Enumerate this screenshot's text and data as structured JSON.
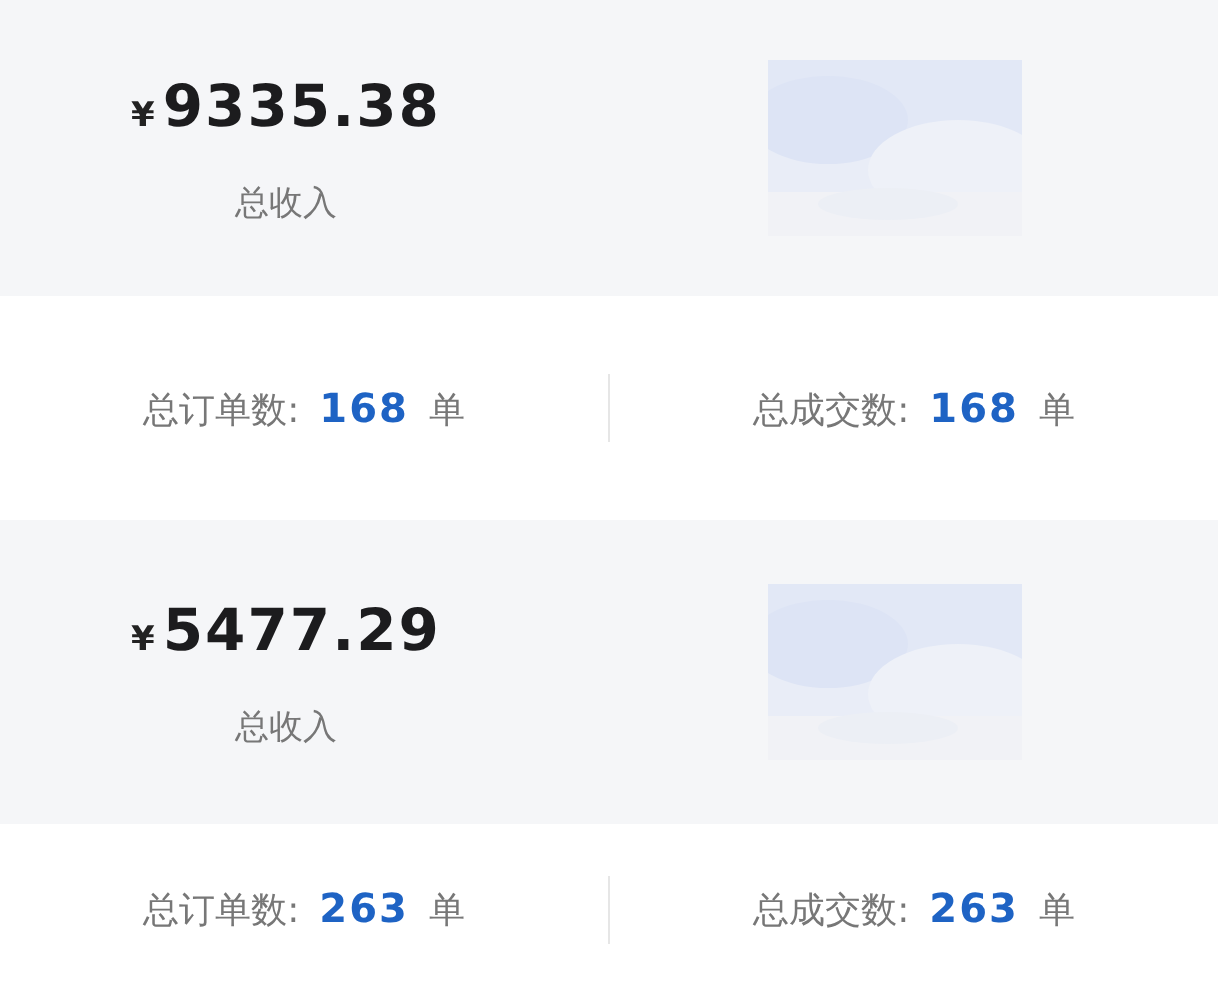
{
  "cards": [
    {
      "currency": "¥",
      "amount": "9335.38",
      "amount_label": "总收入",
      "stats": [
        {
          "label": "总订单数:",
          "value": "168",
          "unit": "单"
        },
        {
          "label": "总成交数:",
          "value": "168",
          "unit": "单"
        }
      ]
    },
    {
      "currency": "¥",
      "amount": "5477.29",
      "amount_label": "总收入",
      "stats": [
        {
          "label": "总订单数:",
          "value": "263",
          "unit": "单"
        },
        {
          "label": "总成交数:",
          "value": "263",
          "unit": "单"
        }
      ]
    }
  ]
}
